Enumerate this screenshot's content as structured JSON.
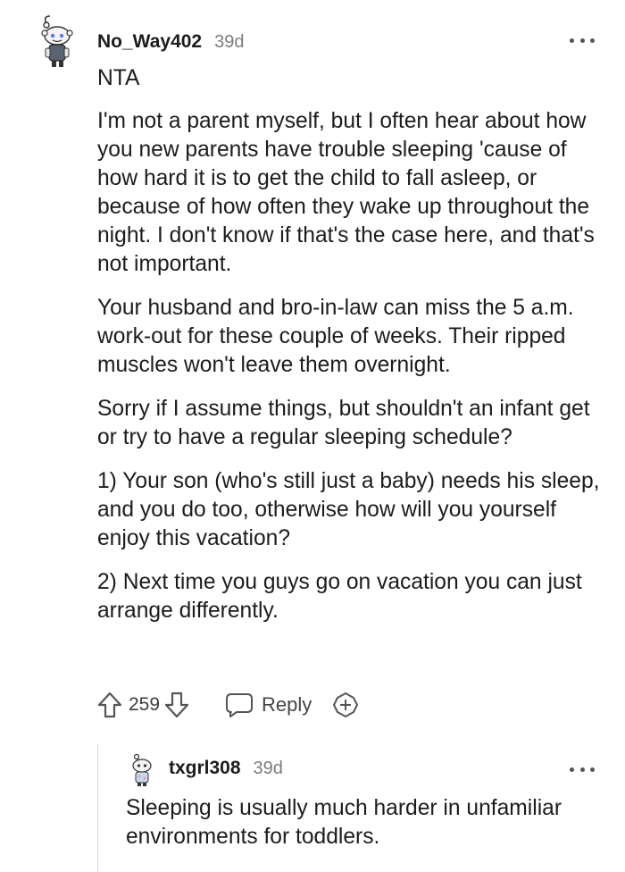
{
  "comment": {
    "username": "No_Way402",
    "time": "39d",
    "paragraphs": [
      "NTA",
      "I'm not a parent myself, but I often hear about how you new parents have trouble sleeping 'cause of how hard it is to get the child to fall asleep, or because of how often they wake up throughout the night. I don't know if that's the case here, and that's not important.",
      "Your husband and bro-in-law can miss the 5 a.m. work-out for these couple of weeks. Their ripped muscles won't leave them overnight.",
      "Sorry if I assume things, but shouldn't an infant get or try to have a regular sleeping schedule?",
      "1) Your son (who's still just a baby) needs his sleep, and you do too, otherwise how will you yourself enjoy this vacation?",
      "2) Next time you guys go on vacation you can just arrange differently."
    ],
    "score": "259",
    "reply_label": "Reply",
    "icons": [
      "more-options-icon",
      "upvote-icon",
      "downvote-icon",
      "reply-icon",
      "award-icon"
    ]
  },
  "reply": {
    "username": "txgrl308",
    "time": "39d",
    "text": "Sleeping is usually much harder in unfamiliar environments for toddlers."
  },
  "colors": {
    "text": "#1c1c1c",
    "meta": "#7c7c7c",
    "icon": "#555555",
    "thread_line": "#dcdcdc"
  }
}
